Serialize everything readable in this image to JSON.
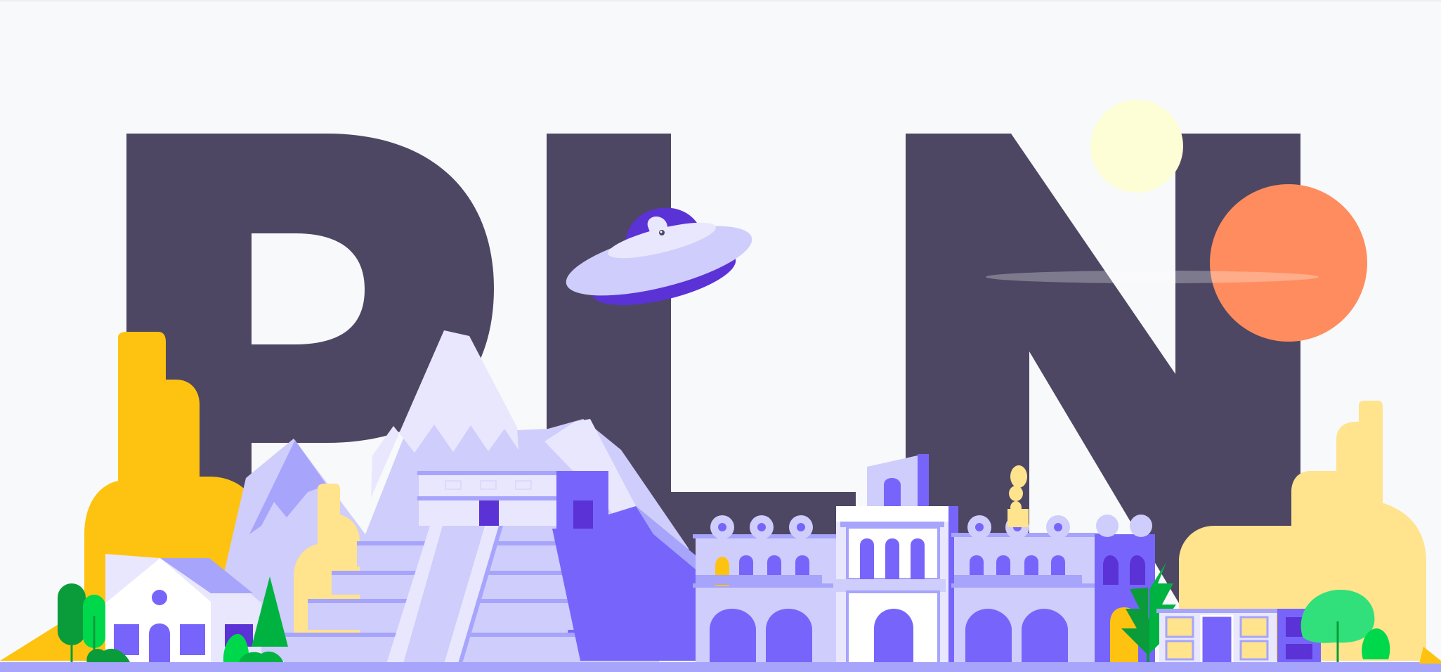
{
  "scene": {
    "letters": [
      "P",
      "L",
      "N"
    ],
    "colors": {
      "background": "#f8f9fb",
      "letters": "#4d4763",
      "sun": "#fdfdd6",
      "planet": "#ff8c5e",
      "ufo_dome": "#5b32d6",
      "ufo_disc": "#cfcdfb",
      "purple": "#7765fb",
      "lilac": "#cfcdfb",
      "pale_lilac": "#e8e7fd",
      "yellow": "#fec310",
      "sand": "#ffe38d",
      "green": "#00b341",
      "dark_green": "#0a9c3b",
      "light_green": "#31e07a",
      "ground": "#a6a4fb"
    },
    "icons": [
      "ufo-icon",
      "sun-icon",
      "planet-icon",
      "house-icon",
      "pyramid-icon",
      "tree-icon",
      "mountain-icon"
    ]
  }
}
